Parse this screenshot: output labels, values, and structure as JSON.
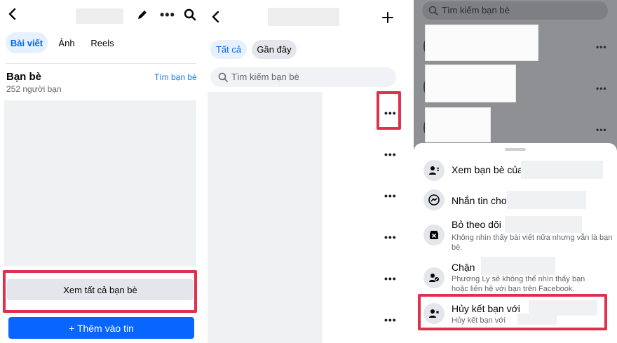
{
  "profile": {
    "tabs": [
      {
        "label": "Bài viết",
        "active": true
      },
      {
        "label": "Ảnh",
        "active": false
      },
      {
        "label": "Reels",
        "active": false
      }
    ],
    "friends_title": "Bạn bè",
    "friends_count": "252 người bạn",
    "find_friends_link": "Tìm bạn bè",
    "see_all_button": "Xem tất cả bạn bè",
    "add_story_button": "+ Thêm vào tin"
  },
  "friends_list": {
    "filters": [
      {
        "label": "Tất cả",
        "active": true
      },
      {
        "label": "Gần đây",
        "active": false
      }
    ],
    "search_placeholder": "Tìm kiếm bạn bè"
  },
  "sheet": {
    "search_placeholder": "Tìm kiếm bạn bè",
    "items": [
      {
        "title": "Xem bạn bè của",
        "subtitle": ""
      },
      {
        "title": "Nhắn tin cho",
        "subtitle": ""
      },
      {
        "title": "Bỏ theo dõi",
        "subtitle": "Không nhìn thấy bài viết nữa nhưng vẫn là bạn bè."
      },
      {
        "title": "Chặn",
        "subtitle": "Phương Ly sẽ không thể nhìn thấy bạn hoặc liên hệ với bạn trên Facebook."
      },
      {
        "title": "Hủy kết bạn với",
        "subtitle": "Hủy kết bạn với"
      }
    ]
  },
  "colors": {
    "accent": "#0866ff",
    "highlight": "#e0304e",
    "link": "#1877f2"
  }
}
